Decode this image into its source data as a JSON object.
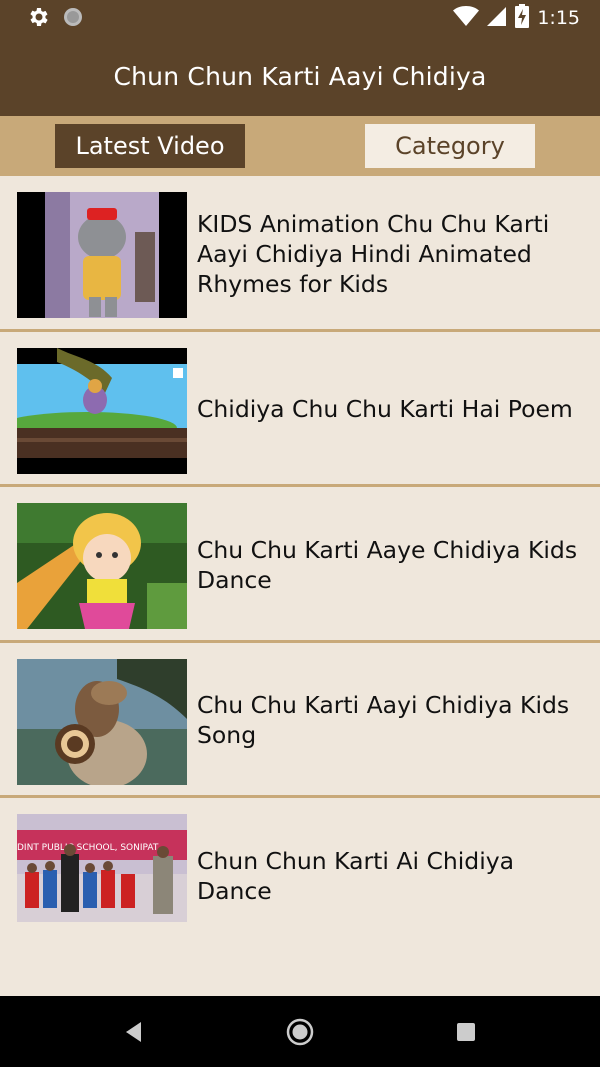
{
  "status_bar": {
    "time": "1:15",
    "icons": [
      "settings-gear-icon",
      "circle-notification-icon",
      "wifi-icon",
      "signal-icon",
      "battery-charging-icon"
    ]
  },
  "app_bar": {
    "title": "Chun Chun Karti Aayi Chidiya"
  },
  "tabs": {
    "latest_label": "Latest Video",
    "category_label": "Category"
  },
  "videos": [
    {
      "title": "KIDS Animation Chu Chu Karti Aayi Chidiya Hindi Animated Rhymes for Kids"
    },
    {
      "title": "Chidiya Chu Chu Karti Hai Poem"
    },
    {
      "title": "Chu Chu Karti Aaye Chidiya Kids Dance"
    },
    {
      "title": "Chu Chu Karti Aayi Chidiya Kids Song"
    },
    {
      "title": "Chun Chun Karti Ai Chidiya Dance",
      "thumb_banner": "DINT PUBLIC SCHOOL, SONIPAT"
    }
  ],
  "nav_bar": {
    "icons": [
      "back-icon",
      "home-icon",
      "recents-icon"
    ]
  },
  "colors": {
    "primary_brown": "#5b4329",
    "tan": "#c8a979",
    "background": "#efe7dc"
  }
}
